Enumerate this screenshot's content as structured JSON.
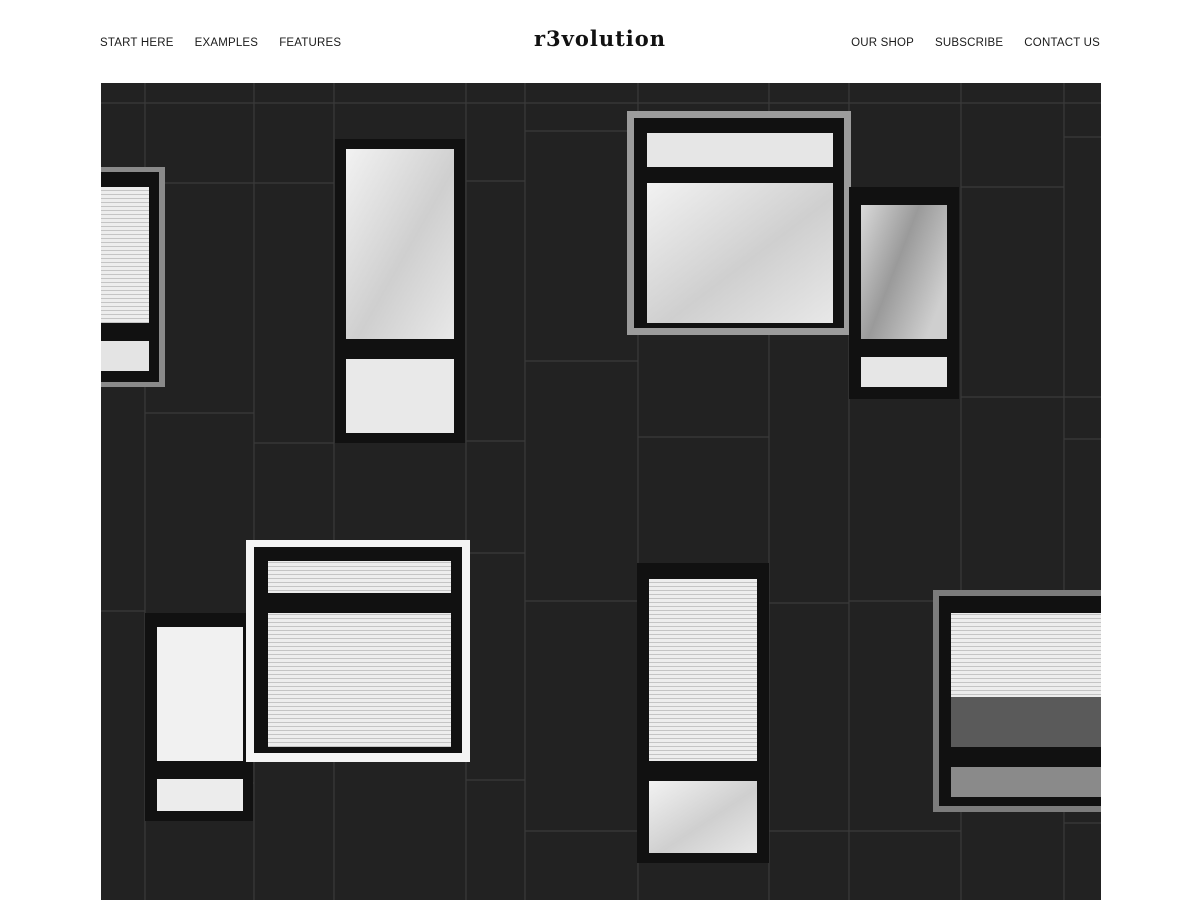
{
  "header": {
    "brand": "r3volution",
    "nav_left": [
      "START HERE",
      "EXAMPLES",
      "FEATURES"
    ],
    "nav_right": [
      "OUR SHOP",
      "SUBSCRIBE",
      "CONTACT US"
    ]
  },
  "hero": {
    "image_subject": "black building facade with square windows",
    "colors": {
      "facade": "#232323",
      "panel_line": "#3a3a3a",
      "frame": "#101010",
      "glass": "#dcdcdc"
    }
  }
}
